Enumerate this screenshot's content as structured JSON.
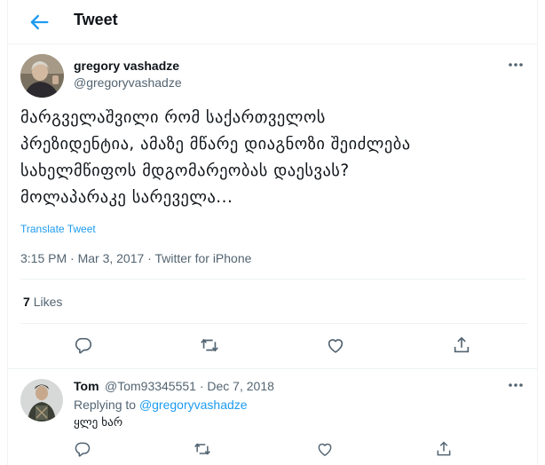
{
  "header": {
    "title": "Tweet"
  },
  "tweet": {
    "author_name": "gregory vashadze",
    "author_handle": "@gregoryvashadze",
    "text_lines": [
      "მარგველაშვილი რომ საქართველოს",
      "პრეზიდენტია, ამაზე მწარე დიაგნოზი შეიძლება",
      "სახელმწიფოს მდგომარეობას დაესვას?",
      "მოლაპარაკე სარეველა..."
    ],
    "translate_label": "Translate Tweet",
    "meta": "3:15 PM · Mar 3, 2017 · Twitter for iPhone",
    "likes_count": "7",
    "likes_label": "Likes"
  },
  "reply": {
    "author_name": "Tom",
    "meta": "@Tom93345551 · Dec 7, 2018",
    "replying_label": "Replying to",
    "replying_to": "@gregoryvashadze",
    "text": "ყლე ხარ"
  },
  "icons": {
    "back": "back-arrow-icon",
    "more": "more-icon",
    "reply": "reply-icon",
    "retweet": "retweet-icon",
    "like": "heart-icon",
    "share": "share-icon"
  },
  "colors": {
    "accent": "#1d9bf0",
    "secondary_text": "#536471",
    "primary_text": "#0f1419",
    "divider": "#eff3f4"
  }
}
